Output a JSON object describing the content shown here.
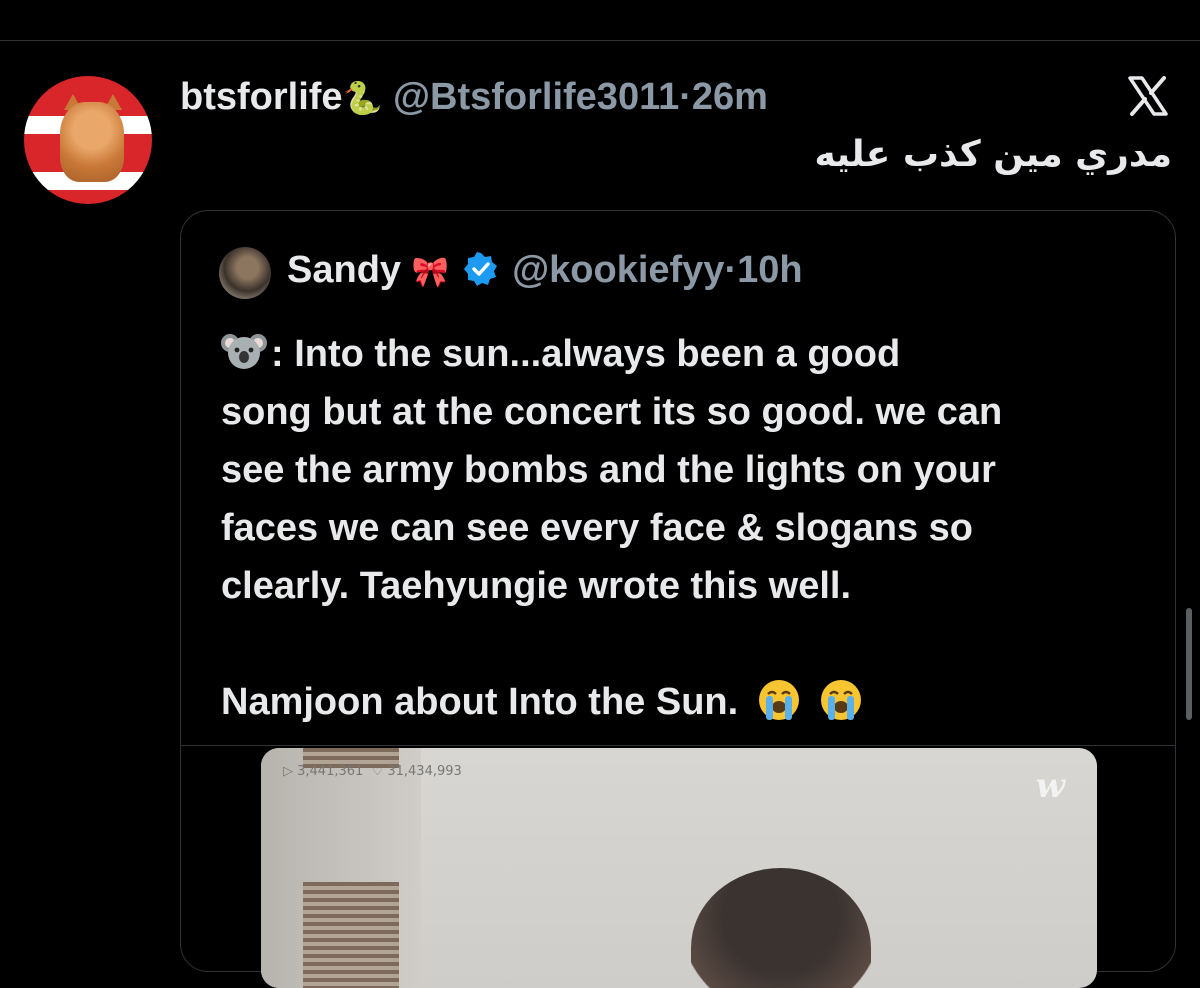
{
  "post": {
    "display_name": "btsforlife",
    "name_emoji": "🐍",
    "handle": "@Btsforlife3011",
    "separator": "·",
    "time": "26m",
    "text": "مدري مين كذب عليه"
  },
  "quoted": {
    "display_name": "Sandy",
    "name_emoji": "🎀",
    "handle": "@kookiefyy",
    "separator": "·",
    "time": "10h",
    "body_line1": ": Into the sun...always been a good",
    "body_line2": "song but at the concert its so good. we can",
    "body_line3": "see the army bombs and the lights on your",
    "body_line4": "faces we can see every face & slogans so",
    "body_line5": "clearly. Taehyungie wrote this well.",
    "body_line6": "Namjoon about Into the Sun.",
    "video": {
      "plays": "▷ 3,441,361",
      "likes": "♡ 31,434,993",
      "watermark": "w"
    }
  },
  "icons": {
    "platform": "x-logo-icon",
    "verified": "verified-badge-icon",
    "koala": "koala-emoji-icon",
    "cry": "loudly-crying-emoji-icon"
  },
  "colors": {
    "background": "#000000",
    "text_primary": "#e7e9ea",
    "text_secondary": "#8b98a5",
    "verified": "#1d9bf0",
    "border": "#2f3336"
  }
}
